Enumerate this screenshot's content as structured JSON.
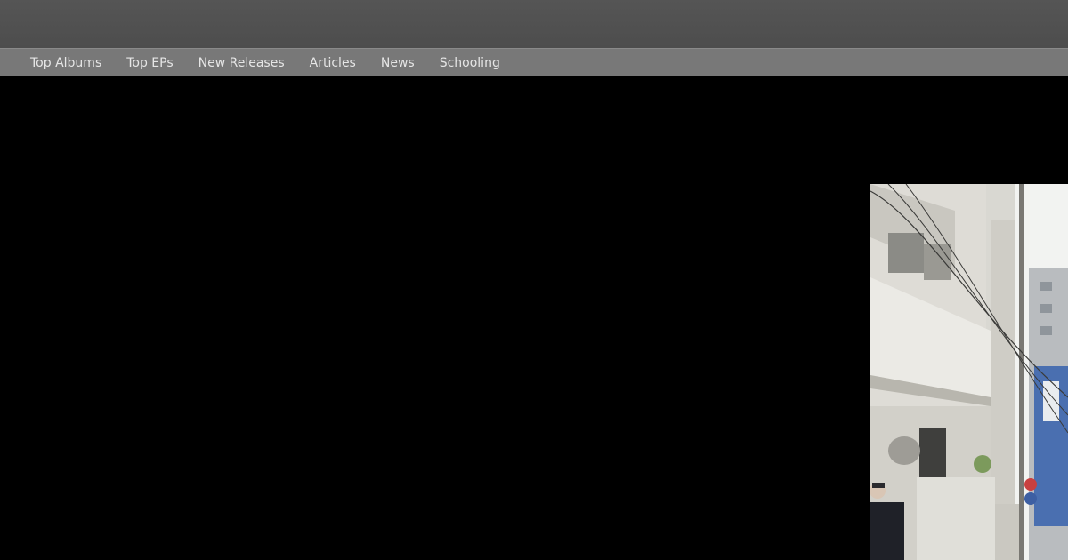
{
  "nav": {
    "items": [
      {
        "label": "Top Albums"
      },
      {
        "label": "Top EPs"
      },
      {
        "label": "New Releases"
      },
      {
        "label": "Articles"
      },
      {
        "label": "News"
      },
      {
        "label": "Schooling"
      }
    ]
  },
  "colors": {
    "header": "#505050",
    "navbar": "#787878",
    "nav_text": "#e6e6e6",
    "background": "#000000"
  }
}
